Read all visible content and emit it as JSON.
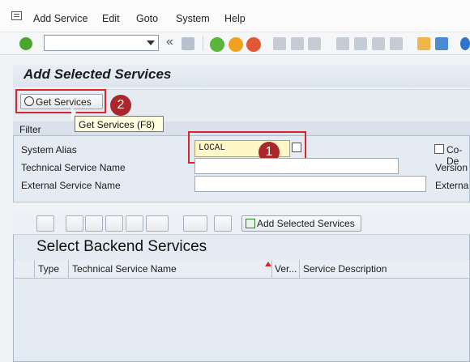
{
  "menu": {
    "items": [
      "Add Service",
      "Edit",
      "Goto",
      "System",
      "Help"
    ],
    "underlined": [
      "A",
      "E",
      "G",
      "S",
      "H"
    ]
  },
  "toolbar": {
    "command_field_value": "",
    "back_glyph": "«",
    "icons": [
      "enter-icon",
      "save-icon",
      "back-icon",
      "exit-icon",
      "cancel-icon",
      "print-icon",
      "find-icon",
      "find-next-icon",
      "first-page-icon",
      "previous-page-icon",
      "next-page-icon",
      "last-page-icon",
      "create-session-icon",
      "shortcut-icon",
      "help-icon"
    ]
  },
  "page": {
    "title": "Add Selected Services"
  },
  "app_toolbar": {
    "get_services_label": "Get Services",
    "tooltip": "Get Services   (F8)"
  },
  "annotations": {
    "badge_1": "1",
    "badge_2": "2",
    "badge_color": "#a9282c",
    "highlight_color": "#d8262b"
  },
  "filter": {
    "title": "Filter",
    "system_alias_label": "System Alias",
    "system_alias_value": "LOCAL",
    "technical_service_name_label": "Technical Service Name",
    "technical_service_name_value": "",
    "external_service_name_label": "External Service Name",
    "external_service_name_value": "",
    "co_dep_label": "Co-De",
    "version_label": "Version",
    "external_right_label": "Externa"
  },
  "grid": {
    "toolbar": {
      "add_selected_services_label": "Add Selected Services",
      "icons": [
        "details-icon",
        "sort-ascending-icon",
        "sort-descending-icon",
        "find-icon",
        "find-next-icon",
        "filter-icon",
        "export-icon",
        "layout-icon"
      ]
    },
    "title": "Select Backend Services",
    "columns": [
      "Type",
      "Technical Service Name",
      "Ver...",
      "Service Description"
    ],
    "rows": []
  }
}
